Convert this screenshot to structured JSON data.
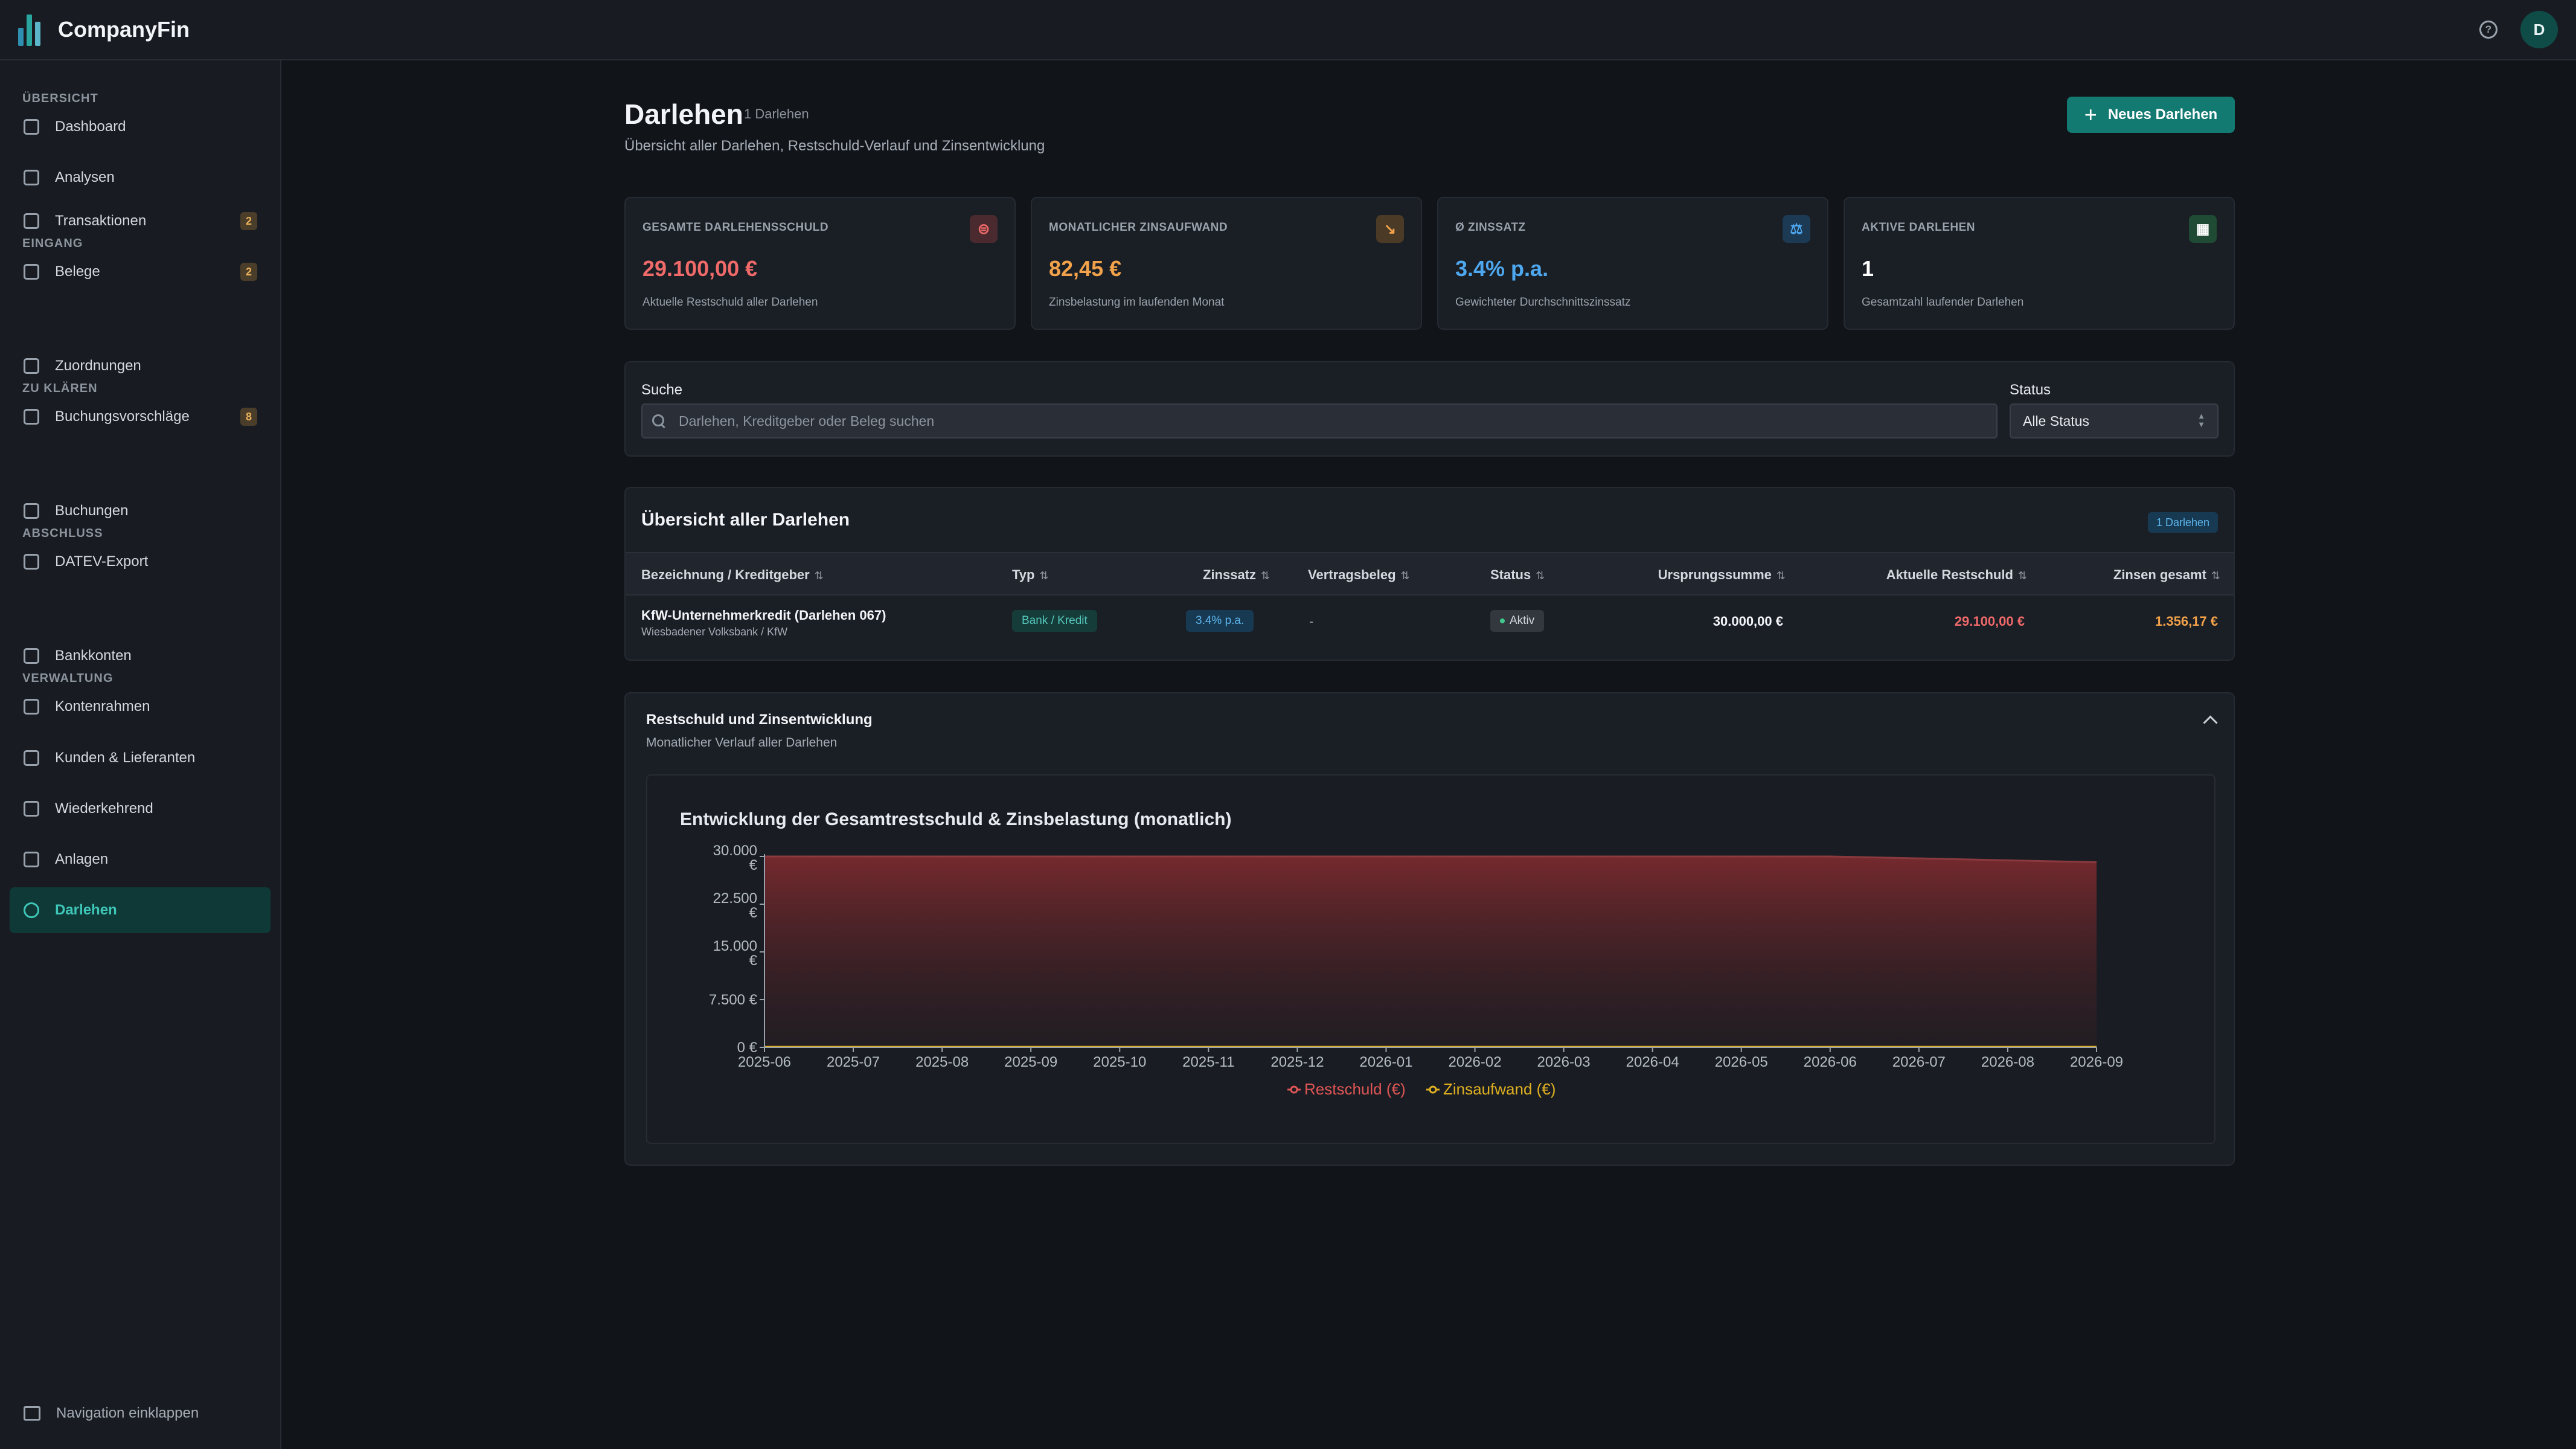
{
  "app": {
    "name": "CompanyFin",
    "help_icon": "help-circle-icon",
    "avatar_initial": "D"
  },
  "sidebar": {
    "sections": [
      {
        "label": "ÜBERSICHT",
        "items": [
          {
            "label": "Dashboard",
            "icon": "grid-icon"
          },
          {
            "label": "Analysen",
            "icon": "bar-chart-icon"
          }
        ]
      },
      {
        "label": "EINGANG",
        "items": [
          {
            "label": "Transaktionen",
            "icon": "arrows-icon",
            "badge": "2"
          },
          {
            "label": "Belege",
            "icon": "receipt-icon",
            "badge": "2"
          }
        ]
      },
      {
        "label": "ZU KLÄREN",
        "items": [
          {
            "label": "Zuordnungen",
            "icon": "link-icon"
          },
          {
            "label": "Buchungsvorschläge",
            "icon": "book-icon",
            "badge": "8"
          }
        ]
      },
      {
        "label": "ABSCHLUSS",
        "items": [
          {
            "label": "Buchungen",
            "icon": "ledger-icon"
          },
          {
            "label": "DATEV-Export",
            "icon": "export-icon"
          }
        ]
      },
      {
        "label": "VERWALTUNG",
        "items": [
          {
            "label": "Bankkonten",
            "icon": "bank-icon"
          },
          {
            "label": "Kontenrahmen",
            "icon": "list-icon"
          },
          {
            "label": "Kunden & Lieferanten",
            "icon": "users-icon"
          },
          {
            "label": "Wiederkehrend",
            "icon": "repeat-icon"
          },
          {
            "label": "Anlagen",
            "icon": "building-icon"
          },
          {
            "label": "Darlehen",
            "icon": "coins-icon",
            "active": true
          }
        ]
      }
    ],
    "collapse_label": "Navigation einklappen"
  },
  "page": {
    "title": "Darlehen",
    "count": "1 Darlehen",
    "subtitle": "Übersicht aller Darlehen, Restschuld-Verlauf und Zinsentwicklung",
    "new_button": "Neues Darlehen"
  },
  "kpis": [
    {
      "label": "GESAMTE DARLEHENSSCHULD",
      "value": "29.100,00 €",
      "desc": "Aktuelle Restschuld aller Darlehen",
      "color": "#f06a6a",
      "icon": "coins-icon",
      "icon_glyph": "⊜",
      "icon_bg": "#4a2a2e"
    },
    {
      "label": "MONATLICHER ZINSAUFWAND",
      "value": "82,45 €",
      "desc": "Zinsbelastung im laufenden Monat",
      "color": "#f2a24a",
      "icon": "trending-down-icon",
      "icon_glyph": "↘",
      "icon_bg": "#4a3a26"
    },
    {
      "label": "Ø ZINSSATZ",
      "value": "3.4% p.a.",
      "desc": "Gewichteter Durchschnittszinssatz",
      "color": "#4ea8ef",
      "icon": "scale-icon",
      "icon_glyph": "⚖",
      "icon_bg": "#1d3a55"
    },
    {
      "label": "AKTIVE DARLEHEN",
      "value": "1",
      "desc": "Gesamtzahl laufender Darlehen",
      "color": "#ffffff",
      "icon": "calendar-icon",
      "icon_glyph": "▦",
      "icon_bg": "#1f4a33"
    }
  ],
  "search": {
    "label": "Suche",
    "placeholder": "Darlehen, Kreditgeber oder Beleg suchen",
    "value": ""
  },
  "status_filter": {
    "label": "Status",
    "value": "Alle Status"
  },
  "table": {
    "title": "Übersicht aller Darlehen",
    "badge": "1 Darlehen",
    "columns": [
      "Bezeichnung / Kreditgeber",
      "Typ",
      "Zinssatz",
      "Vertragsbeleg",
      "Status",
      "Ursprungssumme",
      "Aktuelle Restschuld",
      "Zinsen gesamt"
    ],
    "rows": [
      {
        "name": "KfW-Unternehmerkredit (Darlehen 067)",
        "lender": "Wiesbadener Volksbank / KfW",
        "type": "Bank / Kredit",
        "rate": "3.4% p.a.",
        "document": "-",
        "status": "Aktiv",
        "original": "30.000,00 €",
        "remaining": "29.100,00 €",
        "interest": "1.356,17 €"
      }
    ]
  },
  "chart_section": {
    "title": "Restschuld und Zinsentwicklung",
    "subtitle": "Monatlicher Verlauf aller Darlehen",
    "collapse_icon": "chevron-up-icon"
  },
  "chart_data": {
    "type": "area",
    "title": "Entwicklung der Gesamtrestschuld & Zinsbelastung (monatlich)",
    "x": [
      "2025-06",
      "2025-07",
      "2025-08",
      "2025-09",
      "2025-10",
      "2025-11",
      "2025-12",
      "2026-01",
      "2026-02",
      "2026-03",
      "2026-04",
      "2026-05",
      "2026-06",
      "2026-07",
      "2026-08",
      "2026-09"
    ],
    "y_ticks": [
      "0 €",
      "7.500 €",
      "15.000 €",
      "22.500 €",
      "30.000 €"
    ],
    "ylim": [
      0,
      30000
    ],
    "series": [
      {
        "name": "Restschuld (€)",
        "color": "#e05555",
        "values": [
          30000,
          30000,
          30000,
          30000,
          30000,
          30000,
          30000,
          30000,
          30000,
          30000,
          30000,
          30000,
          30000,
          29700,
          29400,
          29100
        ]
      },
      {
        "name": "Zinsaufwand (€)",
        "color": "#e0b020",
        "values": [
          85,
          85,
          85,
          85,
          85,
          85,
          85,
          85,
          85,
          85,
          85,
          85,
          85,
          84,
          83,
          82.45
        ]
      }
    ],
    "legend": "bottom"
  }
}
